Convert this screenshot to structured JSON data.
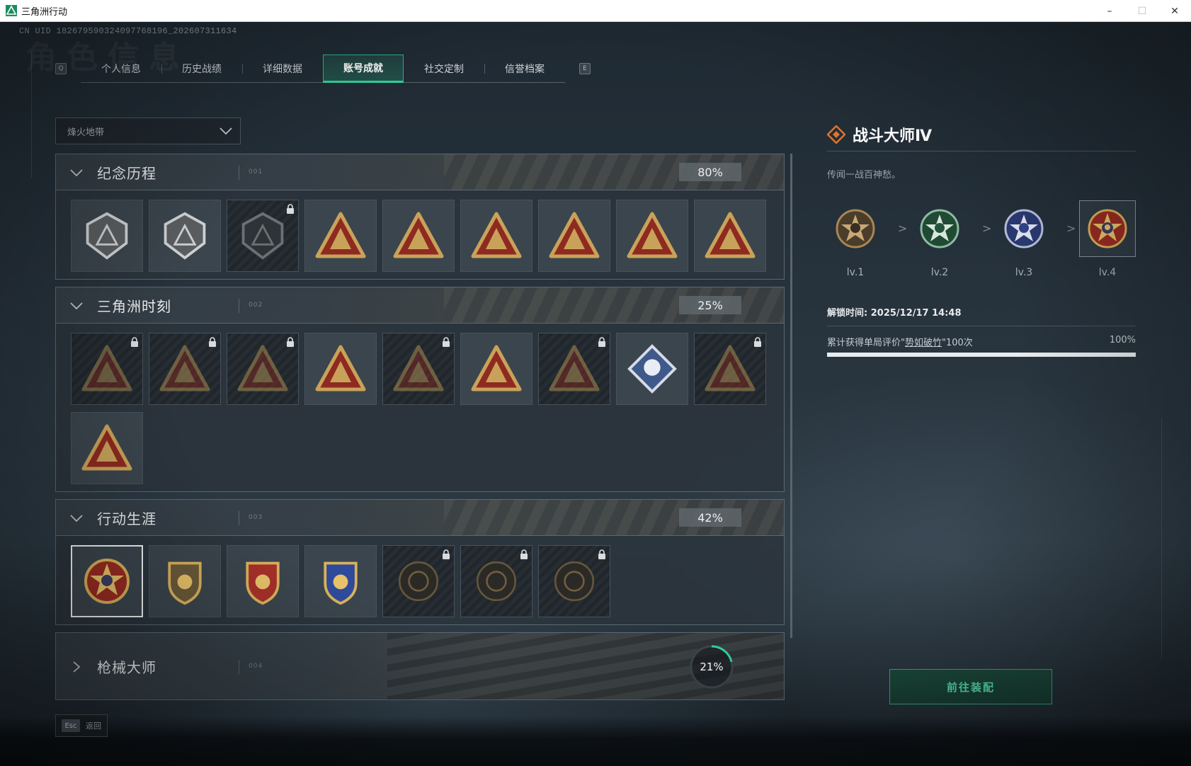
{
  "window": {
    "title": "三角洲行动",
    "min": "–",
    "max": "☐",
    "close": "✕"
  },
  "uid": "CN UID 1826795903240977681​96_202607311634",
  "ghost_title": "角色信息",
  "tabs": {
    "prev_key": "Q",
    "next_key": "E",
    "items": [
      {
        "label": "个人信息",
        "active": false
      },
      {
        "label": "历史战绩",
        "active": false
      },
      {
        "label": "详细数据",
        "active": false
      },
      {
        "label": "账号成就",
        "active": true
      },
      {
        "label": "社交定制",
        "active": false
      },
      {
        "label": "信誉档案",
        "active": false
      }
    ]
  },
  "filter": {
    "selected": "烽火地带"
  },
  "categories": [
    {
      "name": "纪念历程",
      "code": "001",
      "percent": "80%",
      "expanded": true
    },
    {
      "name": "三角洲时刻",
      "code": "002",
      "percent": "25%",
      "expanded": true
    },
    {
      "name": "行动生涯",
      "code": "003",
      "percent": "42%",
      "expanded": true
    },
    {
      "name": "枪械大师",
      "code": "004",
      "percent": "21%",
      "progress": 0.21,
      "expanded": false
    }
  ],
  "detail": {
    "name": "战斗大师Ⅳ",
    "desc": "传闻一战百神愁。",
    "levels": [
      "lv.1",
      "lv.2",
      "lv.3",
      "lv.4"
    ],
    "arrow": ">",
    "unlock_time": "解锁时间: 2025/12/17 14:48",
    "criteria_prefix": "累计获得单局评价\"",
    "criteria_link": "势如破竹",
    "criteria_suffix": "\"100次",
    "criteria_percent": "100%",
    "progress": 1.0
  },
  "equip_button": "前往装配",
  "back": {
    "key": "Esc",
    "label": "返回"
  },
  "colors": {
    "accent": "#2fd49a",
    "gold": "#c9a25a",
    "red": "#8e2a20"
  },
  "icons": {
    "cat1": [
      "mountain-emblem-icon",
      "helicopter-shield-icon",
      "shield-emblem-icon",
      "s6-badge-icon",
      "s8-badge-icon",
      "s9-badge-icon",
      "s10-badge-icon",
      "hands-badge-icon",
      "number-one-badge-icon"
    ],
    "cat2": [
      "robot-badge-icon",
      "diver-badge-icon",
      "crab-badge-icon",
      "soldiers-badge-icon",
      "firefight-badge-icon",
      "rocket-badge-icon",
      "fish-badge-icon",
      "rose-diamond-badge-icon",
      "mask-badge-icon",
      "hazmat-badge-icon"
    ],
    "cat3": [
      "combat-master-medal-icon",
      "eagle-shield-icon",
      "gold-crest-icon",
      "blue-crest-icon",
      "bronze-disc-icon",
      "skull-disc-icon",
      "eye-disc-icon"
    ]
  }
}
